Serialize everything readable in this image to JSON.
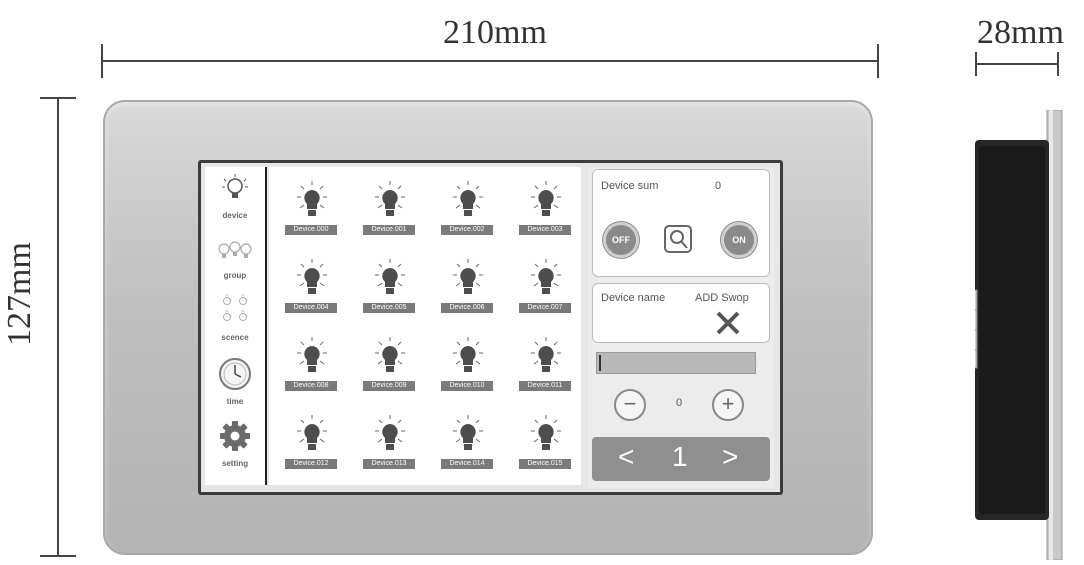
{
  "dimensions": {
    "width": "210mm",
    "height": "127mm",
    "depth": "28mm"
  },
  "sidebar": {
    "items": [
      {
        "label": "device",
        "icon": "bulb-icon"
      },
      {
        "label": "group",
        "icon": "bulb-group-icon"
      },
      {
        "label": "scence",
        "icon": "scene-icon"
      },
      {
        "label": "time",
        "icon": "clock-icon"
      },
      {
        "label": "setting",
        "icon": "gear-icon"
      }
    ]
  },
  "devices": [
    "Device.000",
    "Device.001",
    "Device.002",
    "Device.003",
    "Device.004",
    "Device.005",
    "Device.006",
    "Device.007",
    "Device.008",
    "Device.009",
    "Device.010",
    "Device.011",
    "Device.012",
    "Device.013",
    "Device.014",
    "Device.015"
  ],
  "panel": {
    "device_sum_label": "Device sum",
    "device_sum_value": "0",
    "off_label": "OFF",
    "on_label": "ON",
    "device_name_label": "Device name",
    "add_swop_label": "ADD Swop",
    "counter_value": "0",
    "page_number": "1",
    "prev_glyph": "<",
    "next_glyph": ">",
    "minus_glyph": "−",
    "plus_glyph": "+"
  },
  "colors": {
    "frame": "#c4c4c4",
    "accent_gray": "#8a8a8a"
  }
}
